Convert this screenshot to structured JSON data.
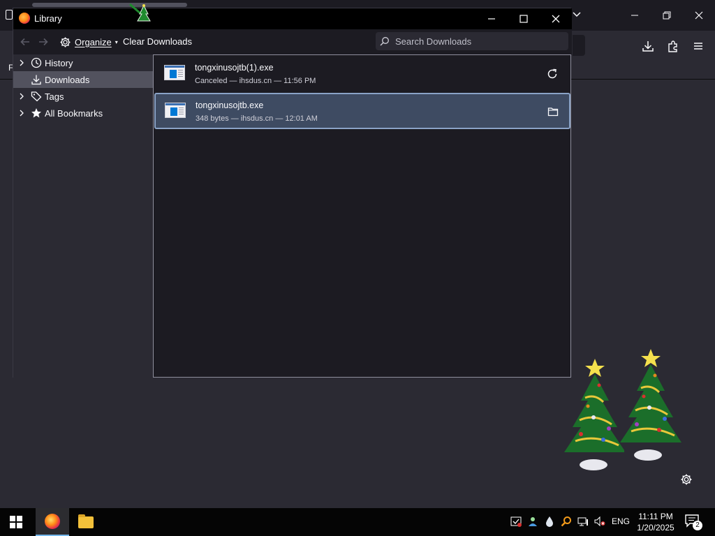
{
  "library": {
    "title": "Library",
    "toolbar": {
      "organize_label": "Organize",
      "clear_downloads_label": "Clear Downloads",
      "search_placeholder": "Search Downloads"
    },
    "sidebar": {
      "items": [
        {
          "label": "History",
          "icon": "clock-icon",
          "expandable": true,
          "selected": false
        },
        {
          "label": "Downloads",
          "icon": "download-icon",
          "expandable": false,
          "selected": true
        },
        {
          "label": "Tags",
          "icon": "tag-icon",
          "expandable": true,
          "selected": false
        },
        {
          "label": "All Bookmarks",
          "icon": "star-icon",
          "expandable": true,
          "selected": false
        }
      ]
    },
    "downloads": [
      {
        "name": "tongxinusojtb(1).exe",
        "status": "Canceled — ihsdus.cn — 11:56 PM",
        "action": "retry-icon",
        "selected": false
      },
      {
        "name": "tongxinusojtb.exe",
        "status": "348 bytes — ihsdus.cn — 12:01 AM",
        "action": "folder-icon",
        "selected": true
      }
    ]
  },
  "browser": {
    "left_letter": "F"
  },
  "taskbar": {
    "language": "ENG",
    "time": "11:11 PM",
    "date": "1/20/2025",
    "notification_count": "2"
  },
  "colors": {
    "window_bg": "#2b2a33",
    "pane_bg": "#1c1b22",
    "selected_row": "#3e4b62",
    "selected_border": "#8aa3c7",
    "taskbar": "#050505",
    "accent": "#76b9ed"
  }
}
